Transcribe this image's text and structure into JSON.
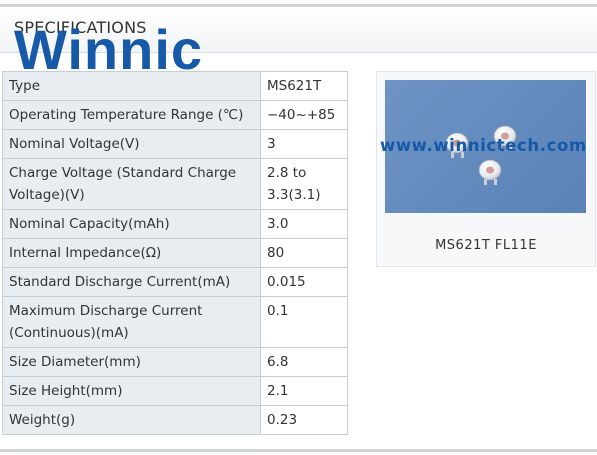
{
  "header": {
    "title": "SPECIFICATIONS"
  },
  "watermark": {
    "logo_text": "Winnic",
    "url": "www.winnictech.com"
  },
  "specs": [
    {
      "label": "Type",
      "value": "MS621T"
    },
    {
      "label": "Operating Temperature Range (℃)",
      "value": "−40~+85"
    },
    {
      "label": "Nominal Voltage(V)",
      "value": "3"
    },
    {
      "label": "Charge Voltage (Standard Charge Voltage)(V)",
      "value": "2.8 to 3.3(3.1)"
    },
    {
      "label": "Nominal Capacity(mAh)",
      "value": "3.0"
    },
    {
      "label": "Internal Impedance(Ω)",
      "value": "80"
    },
    {
      "label": "Standard Discharge Current(mA)",
      "value": "0.015"
    },
    {
      "label": "Maximum Discharge Current (Continuous)(mA)",
      "value": "0.1"
    },
    {
      "label": "Size Diameter(mm)",
      "value": "6.8"
    },
    {
      "label": "Size Height(mm)",
      "value": "2.1"
    },
    {
      "label": "Weight(g)",
      "value": "0.23"
    }
  ],
  "product": {
    "caption": "MS621T FL11E"
  }
}
